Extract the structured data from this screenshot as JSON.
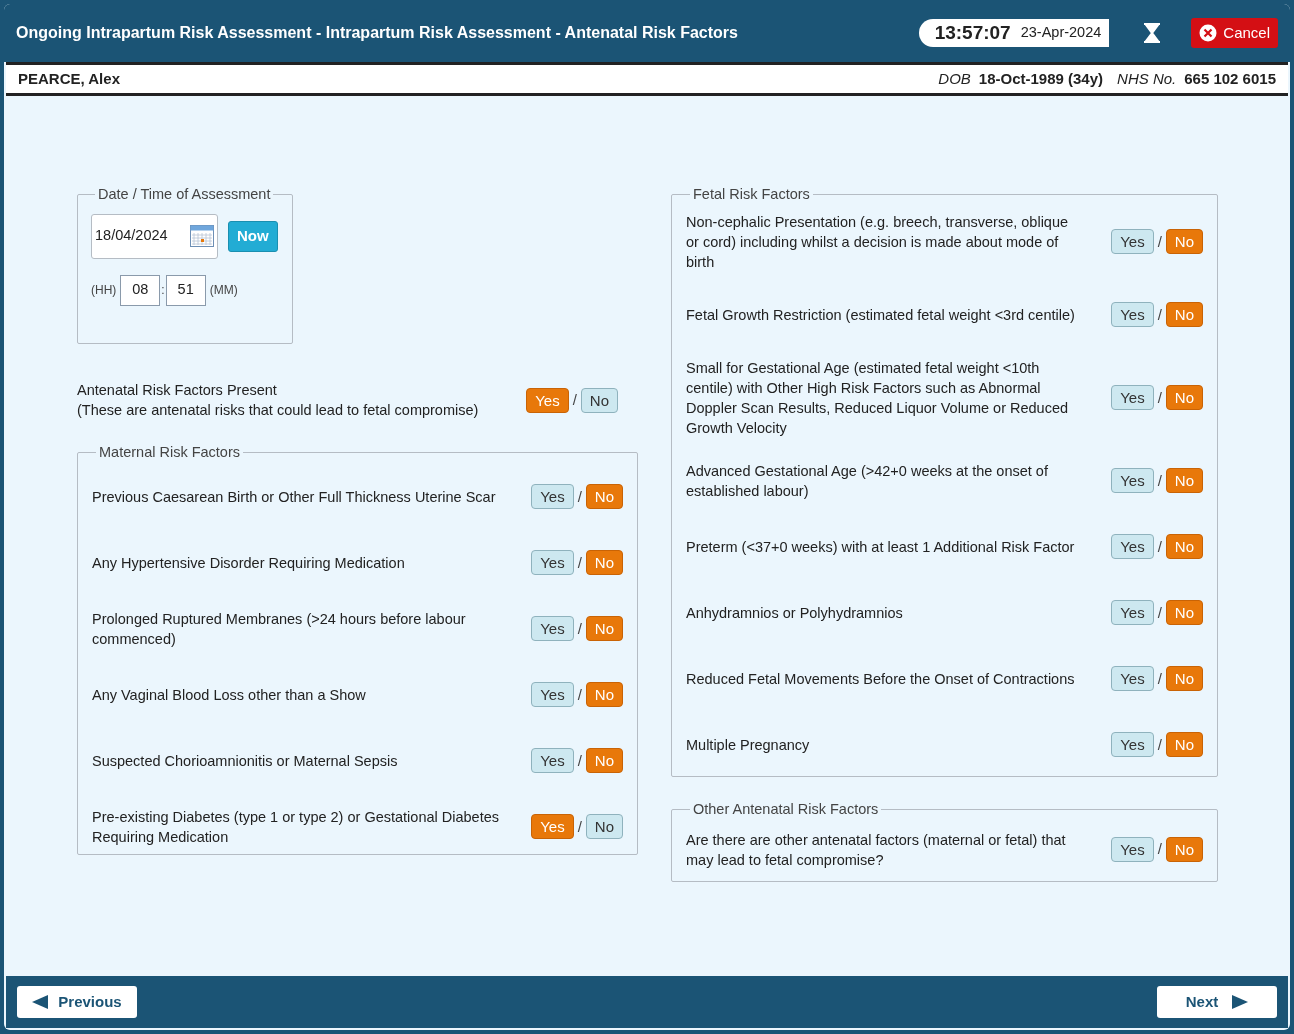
{
  "window": {
    "title": "Ongoing Intrapartum Risk Assessment - Intrapartum Risk Assessment - Antenatal Risk Factors",
    "time": "13:57:07",
    "date": "23-Apr-2024",
    "cancel": "Cancel"
  },
  "patient": {
    "name": "PEARCE, Alex",
    "dob_label": "DOB",
    "dob": "18-Oct-1989 (34y)",
    "nhs_label": "NHS No.",
    "nhs": "665 102 6015"
  },
  "assessment": {
    "legend": "Date / Time of Assessment",
    "date": "18/04/2024",
    "now": "Now",
    "hh_label": "(HH)",
    "hh": "08",
    "colon": ":",
    "mm": "51",
    "mm_label": "(MM)"
  },
  "present": {
    "label": "Antenatal Risk Factors Present",
    "note": "(These are antenatal risks that could lead to fetal compromise)",
    "yes": {
      "label": "Yes",
      "selected": true
    },
    "separator": "/",
    "no": {
      "label": "No",
      "selected": false
    }
  },
  "maternal": {
    "legend": "Maternal Risk Factors",
    "items": [
      {
        "text": "Previous Caesarean Birth or Other Full Thickness Uterine Scar",
        "yes": {
          "label": "Yes",
          "selected": false
        },
        "separator": "/",
        "no": {
          "label": "No",
          "selected": true
        }
      },
      {
        "text": "Any Hypertensive Disorder Requiring Medication",
        "yes": {
          "label": "Yes",
          "selected": false
        },
        "separator": "/",
        "no": {
          "label": "No",
          "selected": true
        }
      },
      {
        "text": "Prolonged Ruptured Membranes (>24 hours before labour commenced)",
        "yes": {
          "label": "Yes",
          "selected": false
        },
        "separator": "/",
        "no": {
          "label": "No",
          "selected": true
        }
      },
      {
        "text": "Any Vaginal Blood Loss other than a Show",
        "yes": {
          "label": "Yes",
          "selected": false
        },
        "separator": "/",
        "no": {
          "label": "No",
          "selected": true
        }
      },
      {
        "text": "Suspected Chorioamnionitis or Maternal Sepsis",
        "yes": {
          "label": "Yes",
          "selected": false
        },
        "separator": "/",
        "no": {
          "label": "No",
          "selected": true
        }
      },
      {
        "text": "Pre-existing Diabetes (type 1 or type 2) or Gestational Diabetes Requiring Medication",
        "yes": {
          "label": "Yes",
          "selected": true
        },
        "separator": "/",
        "no": {
          "label": "No",
          "selected": false
        }
      }
    ]
  },
  "fetal": {
    "legend": "Fetal Risk Factors",
    "items": [
      {
        "text": "Non-cephalic Presentation (e.g. breech, transverse, oblique or cord) including whilst a decision is made about mode of birth",
        "yes": {
          "label": "Yes",
          "selected": false
        },
        "separator": "/",
        "no": {
          "label": "No",
          "selected": true
        }
      },
      {
        "text": "Fetal Growth Restriction (estimated fetal weight <3rd centile)",
        "yes": {
          "label": "Yes",
          "selected": false
        },
        "separator": "/",
        "no": {
          "label": "No",
          "selected": true
        }
      },
      {
        "text": "Small for Gestational Age (estimated fetal weight <10th centile) with Other High Risk Factors such as Abnormal Doppler Scan Results, Reduced Liquor Volume or Reduced Growth Velocity",
        "yes": {
          "label": "Yes",
          "selected": false
        },
        "separator": "/",
        "no": {
          "label": "No",
          "selected": true
        }
      },
      {
        "text": "Advanced Gestational Age (>42+0 weeks at the onset of established labour)",
        "yes": {
          "label": "Yes",
          "selected": false
        },
        "separator": "/",
        "no": {
          "label": "No",
          "selected": true
        }
      },
      {
        "text": "Preterm (<37+0 weeks) with at least 1 Additional Risk Factor",
        "yes": {
          "label": "Yes",
          "selected": false
        },
        "separator": "/",
        "no": {
          "label": "No",
          "selected": true
        }
      },
      {
        "text": "Anhydramnios or Polyhydramnios",
        "yes": {
          "label": "Yes",
          "selected": false
        },
        "separator": "/",
        "no": {
          "label": "No",
          "selected": true
        }
      },
      {
        "text": "Reduced Fetal Movements Before the Onset of Contractions",
        "yes": {
          "label": "Yes",
          "selected": false
        },
        "separator": "/",
        "no": {
          "label": "No",
          "selected": true
        }
      },
      {
        "text": "Multiple Pregnancy",
        "yes": {
          "label": "Yes",
          "selected": false
        },
        "separator": "/",
        "no": {
          "label": "No",
          "selected": true
        }
      }
    ]
  },
  "other": {
    "legend": "Other Antenatal Risk Factors",
    "items": [
      {
        "text": "Are there are other antenatal factors (maternal or fetal) that may lead to fetal compromise?",
        "yes": {
          "label": "Yes",
          "selected": false
        },
        "separator": "/",
        "no": {
          "label": "No",
          "selected": true
        }
      }
    ]
  },
  "footer": {
    "previous": "Previous",
    "next": "Next"
  }
}
